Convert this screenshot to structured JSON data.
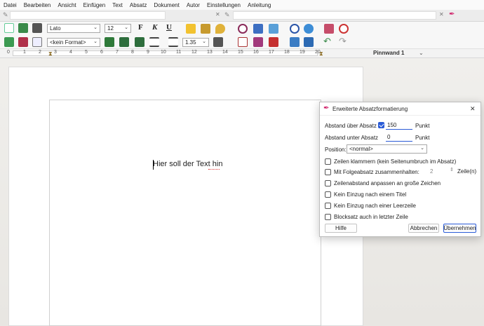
{
  "menu": [
    "Datei",
    "Bearbeiten",
    "Ansicht",
    "Einfügen",
    "Text",
    "Absatz",
    "Dokument",
    "Autor",
    "Einstellungen",
    "Anleitung"
  ],
  "toolbar": {
    "font_name": "Lato",
    "font_size": "12",
    "bold_label": "F",
    "italic_label": "K",
    "underline_label": "U",
    "format_style": "<kein Format>",
    "line_spacing": "1.35"
  },
  "ruler": {
    "ticks": [
      "0",
      "1",
      "2",
      "3",
      "4",
      "5",
      "6",
      "7",
      "8",
      "9",
      "10",
      "11",
      "12",
      "13",
      "14",
      "15",
      "16",
      "17",
      "18",
      "19",
      "20"
    ],
    "board_label": "Pinnwand 1"
  },
  "document": {
    "text": "Hier soll der Text hin"
  },
  "dialog": {
    "title": "Erweiterte Absatzformatierung",
    "space_above_label": "Abstand über Absatz",
    "space_above_value": "150",
    "space_above_unit": "Punkt",
    "space_below_label": "Abstand unter Absatz",
    "space_below_value": "0",
    "space_below_unit": "Punkt",
    "position_label": "Position:",
    "position_value": "<normal>",
    "keep_lines_label": "Zeilen klammern (kein Seitenumbruch im Absatz)",
    "keep_next_label": "Mit Folgeabsatz zusammenhalten:",
    "keep_next_count": "2",
    "keep_next_unit": "Zeile(n)",
    "adjust_spacing_label": "Zeilenabstand anpassen an große Zeichen",
    "no_indent_title_label": "Kein Einzug nach einem Titel",
    "no_indent_empty_label": "Kein Einzug nach einer Leerzeile",
    "justify_last_label": "Blocksatz auch in letzter Zeile",
    "help_button": "Hilfe",
    "cancel_button": "Abbrechen",
    "apply_button": "Übernehmen",
    "close_glyph": "✕"
  },
  "colors": {
    "accent": "#2a5bd7",
    "app_icon": "#d0246b"
  }
}
